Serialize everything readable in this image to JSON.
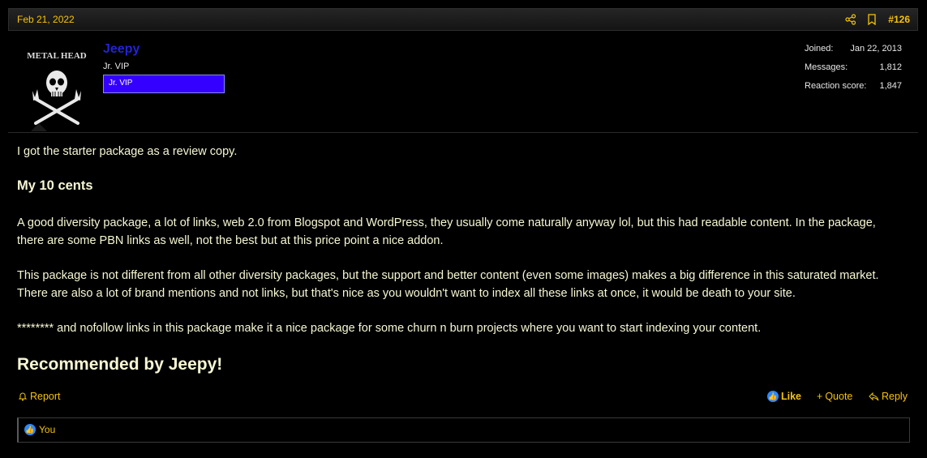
{
  "post": {
    "date": "Feb 21, 2022",
    "number": "#126"
  },
  "user": {
    "avatar_text": "METAL HEAD",
    "name": "Jeepy",
    "title": "Jr. VIP",
    "banner": "Jr. VIP",
    "stats": [
      {
        "label": "Joined:",
        "value": "Jan 22, 2013"
      },
      {
        "label": "Messages:",
        "value": "1,812"
      },
      {
        "label": "Reaction score:",
        "value": "1,847"
      }
    ]
  },
  "content": {
    "intro": "I got the starter package as a review copy.",
    "heading": "My 10 cents",
    "p1": "A good diversity package, a lot of links, web 2.0 from Blogspot and WordPress, they usually come naturally anyway lol, but this had readable content. In the package, there are some PBN links as well, not the best but at this price point a nice addon.",
    "p2": "This package is not different from all other diversity packages, but the support and better content (even some images) makes a big difference in this saturated market. There are also a lot of brand mentions and not links, but that's nice as you wouldn't want to index all these links at once, it would be death to your site.",
    "p3": "******** and nofollow links in this package make it a nice package for some churn n burn projects where you want to start indexing your content.",
    "recommend": "Recommended by Jeepy!"
  },
  "actions": {
    "report": "Report",
    "like": "Like",
    "quote": "Quote",
    "reply": "Reply"
  },
  "reactions": {
    "by": "You"
  },
  "icons": [
    "share-icon",
    "bookmark-icon",
    "bell-icon",
    "like-icon",
    "plus-icon",
    "reply-icon"
  ],
  "colors": {
    "accent": "#f4c20d",
    "username": "#2323d6",
    "banner": "#3400ff",
    "like": "#2d88ff"
  }
}
